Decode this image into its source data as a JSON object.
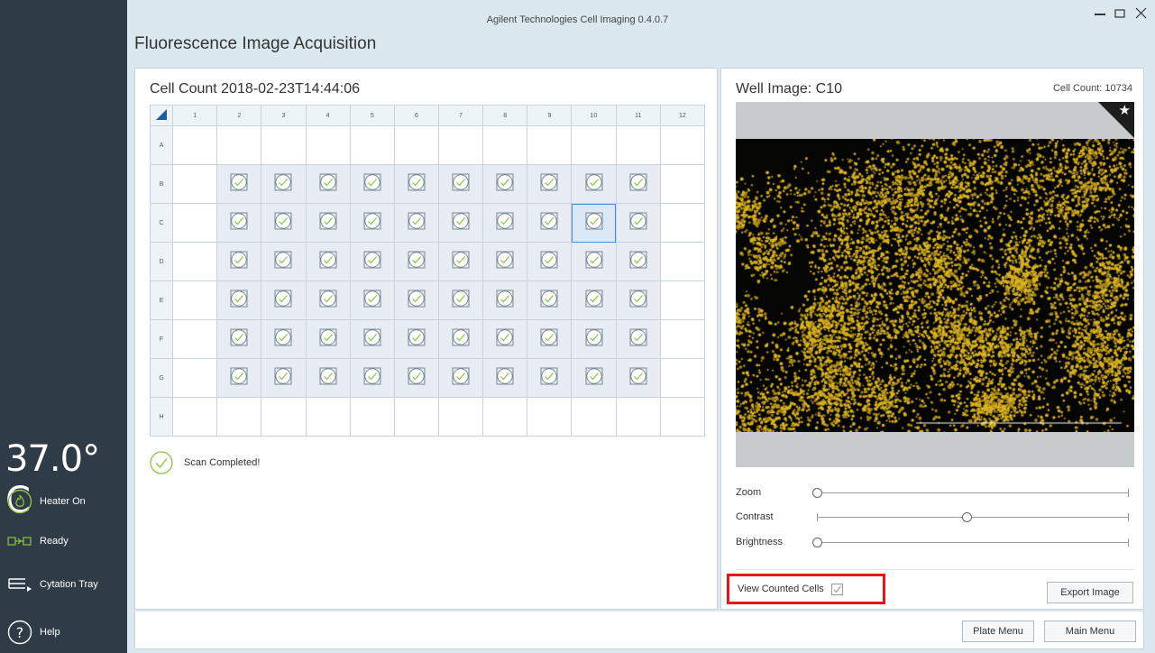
{
  "app": {
    "title": "Agilent Technologies Cell Imaging 0.4.0.7",
    "page_title": "Fluorescence Image Acquisition"
  },
  "window": {
    "minimize_icon": "minus-icon",
    "maximize_icon": "square-icon",
    "close_icon": "x-icon"
  },
  "sidebar": {
    "temperature": "37.0° C",
    "items": [
      {
        "label": "Heater On",
        "icon": "flame-icon"
      },
      {
        "label": "Ready",
        "icon": "connection-icon"
      },
      {
        "label": "Cytation Tray",
        "icon": "tray-icon"
      },
      {
        "label": "Help",
        "icon": "help-icon"
      }
    ]
  },
  "plate": {
    "title": "Cell Count 2018-02-23T14:44:06",
    "columns": [
      "1",
      "2",
      "3",
      "4",
      "5",
      "6",
      "7",
      "8",
      "9",
      "10",
      "11",
      "12"
    ],
    "rows": [
      "A",
      "B",
      "C",
      "D",
      "E",
      "F",
      "G",
      "H"
    ],
    "scanned_rows": [
      "B",
      "C",
      "D",
      "E",
      "F",
      "G"
    ],
    "scanned_columns": [
      "2",
      "3",
      "4",
      "5",
      "6",
      "7",
      "8",
      "9",
      "10",
      "11"
    ],
    "selected_well": "C10",
    "status": "Scan Completed!"
  },
  "well": {
    "title": "Well Image: C10",
    "cell_count": "Cell Count: 10734",
    "favorite_icon": "star-icon"
  },
  "controls": {
    "zoom": {
      "label": "Zoom",
      "level": 0.0
    },
    "contrast": {
      "label": "Contrast",
      "level": 0.48
    },
    "brightness": {
      "label": "Brightness",
      "level": 0.0
    },
    "view_counted": {
      "label": "View Counted Cells",
      "checked": true
    },
    "export_label": "Export Image"
  },
  "footer": {
    "plate_menu": "Plate Menu",
    "main_menu": "Main Menu"
  },
  "colors": {
    "sidebar": "#2f3b46",
    "accent_green": "#8cc63f",
    "highlight_red": "#e8141a",
    "cell_yellow": "#d9b21f"
  }
}
